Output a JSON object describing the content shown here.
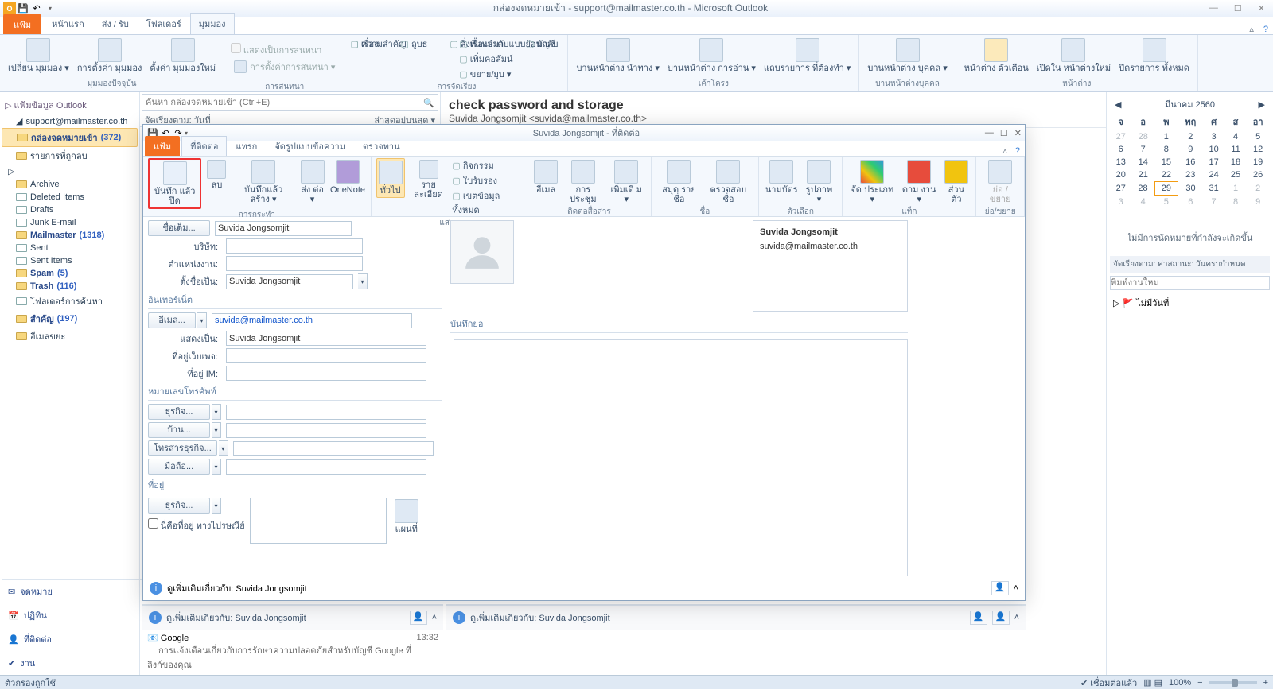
{
  "window": {
    "title": "กล่องจดหมายเข้า - support@mailmaster.co.th - Microsoft Outlook"
  },
  "tabs": {
    "file": "แฟ้ม",
    "home": "หน้าแรก",
    "sendrecv": "ส่ง / รับ",
    "folder": "โฟลเดอร์",
    "view": "มุมมอง"
  },
  "ribbon_main": {
    "g1": {
      "b1": "เปลี่ยน\nมุมมอง ▾",
      "b2": "การตั้งค่า\nมุมมอง",
      "b3": "ตั้งค่า\nมุมมองใหม่",
      "label": "มุมมองปัจจุบัน"
    },
    "g2": {
      "chk": "แสดงเป็นการสนทนา",
      "dd": "การตั้งค่าการสนทนา ▾",
      "label": "การสนทนา"
    },
    "g3": {
      "l1": "เรื่อง",
      "l2": "ถูบธ",
      "l3": "สิ่งที่แนบมา",
      "l4": "บัญชี",
      "hdr": "ความสำคัญ",
      "l5": "เรื่องลำดับแบบย้อนกลับ",
      "l6": "เพิ่มคอลัมน์",
      "l7": "ขยาย/ยุบ ▾",
      "label": "การจัดเรียง"
    },
    "g4": {
      "b1": "บานหน้าต่าง\nนำทาง ▾",
      "b2": "บานหน้าต่าง\nการอ่าน ▾",
      "b3": "แถบรายการ\nที่ต้องทำ ▾",
      "label": "เค้าโครง"
    },
    "g5": {
      "b1": "บานหน้าต่าง\nบุคคล ▾",
      "label": "บานหน้าต่างบุคคล"
    },
    "g6": {
      "b1": "หน้าต่าง\nตัวเตือน",
      "b2": "เปิดใน\nหน้าต่างใหม่",
      "b3": "ปิดรายการ\nทั้งหมด",
      "label": "หน้าต่าง"
    }
  },
  "nav": {
    "hdr1": "▷ แฟ้มข้อมูล Outlook",
    "acct": "support@mailmaster.co.th",
    "inbox": "กล่องจดหมายเข้า",
    "inbox_cnt": "(372)",
    "todo": "รายการที่ถูกลบ",
    "archive": "Archive",
    "deleted": "Deleted Items",
    "drafts": "Drafts",
    "junk": "Junk E-mail",
    "mailmaster": "Mailmaster",
    "mailmaster_cnt": "(1318)",
    "sent": "Sent",
    "sentitems": "Sent Items",
    "spam": "Spam",
    "spam_cnt": "(5)",
    "trash": "Trash",
    "trash_cnt": "(116)",
    "searchf": "โฟลเดอร์การค้นหา",
    "important": "สำคัญ",
    "important_cnt": "(197)",
    "junk2": "อีเมลขยะ",
    "mail_lnk": "จดหมาย",
    "cal_lnk": "ปฏิทิน",
    "contact_lnk": "ที่ติดต่อ",
    "tasks_lnk": "งาน"
  },
  "search": {
    "placeholder": "ค้นหา กล่องจดหมายเข้า (Ctrl+E)"
  },
  "sort": {
    "left": "จัดเรียงตาม: วันที่",
    "right": "ล่าสุดอยู่บนสุด ▾"
  },
  "preview": {
    "subject": "check password and storage",
    "from": "Suvida Jongsomjit <suvida@mailmaster.co.th>"
  },
  "msglist": {
    "r1_from": "Google",
    "r1_time": "13:32",
    "r1_sub": "การแจ้งเตือนเกี่ยวกับการรักษาความปลอดภัยสำหรับบัญชี Google ที่ลิงก์ของคุณ"
  },
  "info": {
    "main": "ดูเพิ่มเติมเกี่ยวกับ: Suvida Jongsomjit",
    "reading": "ดูเพิ่มเติมเกี่ยวกับ: Suvida Jongsomjit"
  },
  "cal": {
    "title": "มีนาคม 2560",
    "dow": [
      "จ",
      "อ",
      "พ",
      "พฤ",
      "ศ",
      "ส",
      "อา"
    ],
    "no_appt": "ไม่มีการนัดหมายที่กำลังจะเกิดขึ้น"
  },
  "tasks": {
    "hdr": "จัดเรียงตาม: ค่าสถานะ: วันครบกำหนด",
    "input_ph": "พิมพ์งานใหม่",
    "empty": "ไม่มีวันที่"
  },
  "contact": {
    "title": "Suvida Jongsomjit - ที่ติดต่อ",
    "tabs": {
      "file": "แฟ้ม",
      "contact": "ที่ติดต่อ",
      "insert": "แทรก",
      "format": "จัดรูปแบบข้อความ",
      "review": "ตรวจทาน"
    },
    "rb": {
      "save": "บันทึก\nแล้วปิด",
      "del": "ลบ",
      "savenew": "บันทึกแล้ว\nสร้าง ▾",
      "fwd": "ส่ง\nต่อ ▾",
      "onenote": "OneNote",
      "g1": "การกระทำ",
      "gen": "ทั่วไป",
      "details": "รายละเอียด",
      "activities": "กิจกรรม",
      "cert": "ใบรับรอง",
      "allf": "เขตข้อมูลทั้งหมด",
      "g2": "แสดง",
      "email": "อีเมล",
      "meeting": "การ\nประชุม",
      "more": "เพิ่มเติ\nม ▾",
      "g3": "ติดต่อสื่อสาร",
      "book": "สมุด\nรายชื่อ",
      "check": "ตรวจสอบ\nชื่อ",
      "g4": "ชื่อ",
      "bcard": "นามบัตร",
      "pic": "รูปภาพ\n▾",
      "g5": "ตัวเลือก",
      "cat": "จัด\nประเภท ▾",
      "flag": "ตาม\nงาน ▾",
      "priv": "ส่วนตัว",
      "g6": "แท็ก",
      "zoom": "ย่อ\n/ขยาย",
      "g7": "ย่อ/ขยาย"
    },
    "form": {
      "name_btn": "ชื่อเต็ม...",
      "name_val": "Suvida Jongsomjit",
      "company": "บริษัท:",
      "jobtitle": "ตำแหน่งงาน:",
      "fileas": "ตั้งชื่อเป็น:",
      "fileas_val": "Suvida Jongsomjit",
      "sect_net": "อินเทอร์เน็ต",
      "email_btn": "อีเมล...",
      "email_val": "suvida@mailmaster.co.th",
      "display": "แสดงเป็น:",
      "display_val": "Suvida Jongsomjit",
      "web": "ที่อยู่เว็บเพจ:",
      "im": "ที่อยู่ IM:",
      "sect_phone": "หมายเลขโทรศัพท์",
      "p1": "ธุรกิจ...",
      "p2": "บ้าน...",
      "p3": "โทรสารธุรกิจ...",
      "p4": "มือถือ...",
      "sect_addr": "ที่อยู่",
      "addr_btn": "ธุรกิจ...",
      "mail_chk": "นี่คือที่อยู่\nทางไปรษณีย์",
      "map": "แผนที่",
      "notes_lbl": "บันทึกย่อ"
    },
    "card": {
      "name": "Suvida Jongsomjit",
      "email": "suvida@mailmaster.co.th"
    }
  },
  "status": {
    "left": "ตัวกรองถูกใช้",
    "conn": "เชื่อมต่อแล้ว",
    "zoom": "100%"
  }
}
